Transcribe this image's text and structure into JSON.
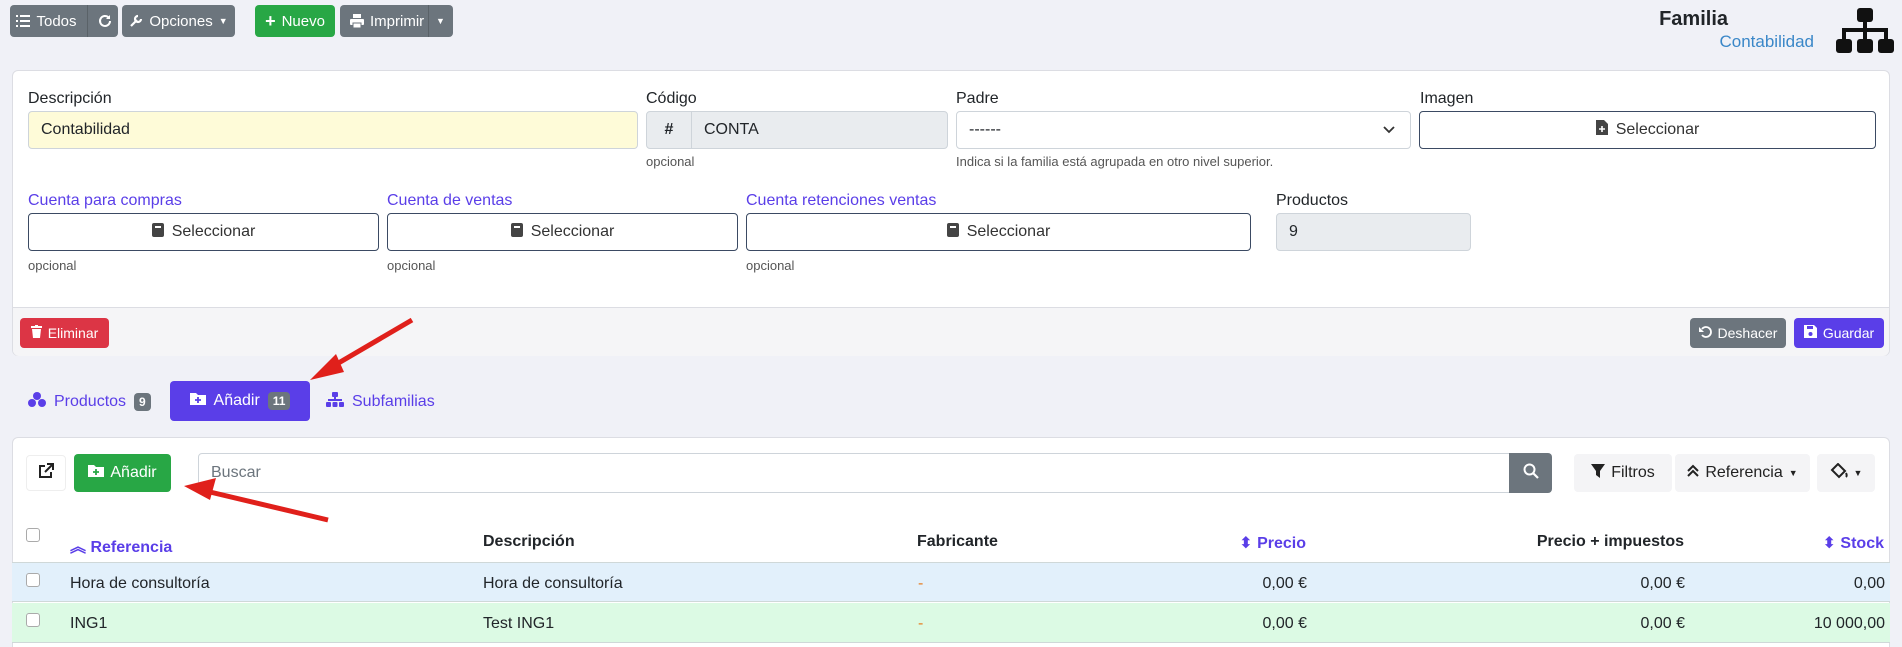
{
  "toolbar": {
    "todos_label": "Todos",
    "opciones_label": "Opciones",
    "nuevo_label": "Nuevo",
    "imprimir_label": "Imprimir"
  },
  "header": {
    "title": "Familia",
    "subtitle": "Contabilidad"
  },
  "form": {
    "descripcion_label": "Descripción",
    "descripcion_value": "Contabilidad",
    "codigo_label": "Código",
    "codigo_prefix": "#",
    "codigo_value": "CONTA",
    "codigo_help": "opcional",
    "padre_label": "Padre",
    "padre_value": "------",
    "padre_help": "Indica si la familia está agrupada en otro nivel superior.",
    "imagen_label": "Imagen",
    "imagen_button": "Seleccionar",
    "cuenta_compras_label": "Cuenta para compras",
    "cuenta_compras_button": "Seleccionar",
    "cuenta_compras_help": "opcional",
    "cuenta_ventas_label": "Cuenta de ventas",
    "cuenta_ventas_button": "Seleccionar",
    "cuenta_ventas_help": "opcional",
    "cuenta_ret_label": "Cuenta retenciones ventas",
    "cuenta_ret_button": "Seleccionar",
    "cuenta_ret_help": "opcional",
    "productos_label": "Productos",
    "productos_value": "9"
  },
  "actions": {
    "eliminar": "Eliminar",
    "deshacer": "Deshacer",
    "guardar": "Guardar"
  },
  "tabs": [
    {
      "label": "Productos",
      "count": "9"
    },
    {
      "label": "Añadir",
      "count": "11"
    },
    {
      "label": "Subfamilias",
      "count": ""
    }
  ],
  "list": {
    "add_label": "Añadir",
    "search_placeholder": "Buscar",
    "filtros_label": "Filtros",
    "orden_label": "Referencia"
  },
  "table": {
    "headers": [
      "Referencia",
      "Descripción",
      "Fabricante",
      "Precio",
      "Precio + impuestos",
      "Stock"
    ],
    "rows": [
      {
        "referencia": "Hora de consultoría",
        "descripcion": "Hora de consultoría",
        "fabricante": "-",
        "precio": "0,00 €",
        "precio_imp": "0,00 €",
        "stock": "0,00"
      },
      {
        "referencia": "ING1",
        "descripcion": "Test ING1",
        "fabricante": "-",
        "precio": "0,00 €",
        "precio_imp": "0,00 €",
        "stock": "10 000,00"
      }
    ]
  },
  "colors": {
    "accent": "#5a3ee8",
    "green": "#28a745",
    "red": "#dc3545",
    "row_blue": "#e2f0fb",
    "row_green": "#dcfae4",
    "arrow": "#e0201b"
  }
}
